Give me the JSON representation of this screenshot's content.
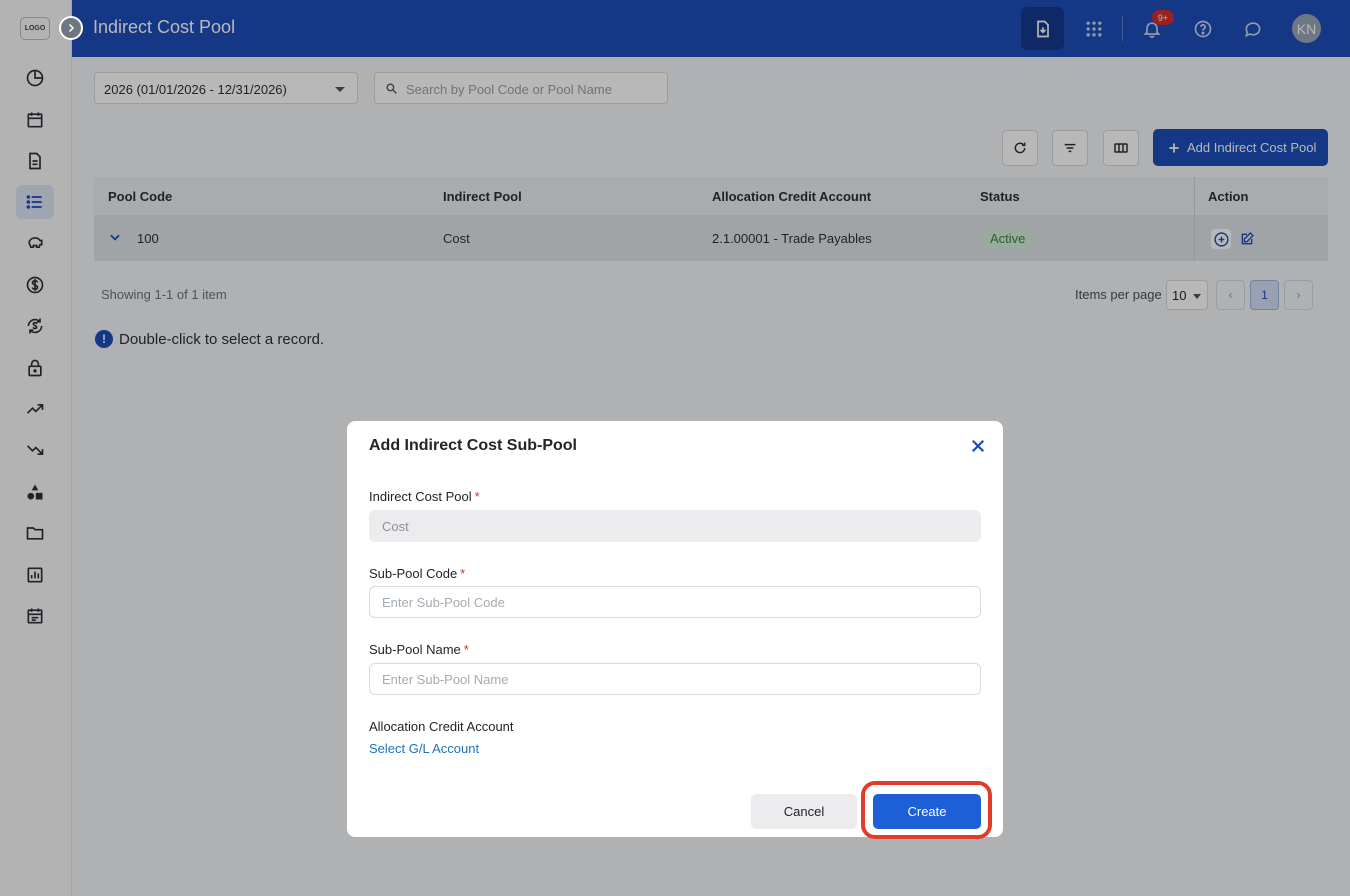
{
  "sidebar": {
    "logo_text": "LOGO",
    "items": [
      {
        "icon": "pie-chart-icon",
        "active": false
      },
      {
        "icon": "calendar-icon",
        "active": false
      },
      {
        "icon": "document-icon",
        "active": false
      },
      {
        "icon": "list-icon",
        "active": true
      },
      {
        "icon": "piggy-bank-icon",
        "active": false
      },
      {
        "icon": "dollar-icon",
        "active": false
      },
      {
        "icon": "currency-exchange-icon",
        "active": false
      },
      {
        "icon": "lock-icon",
        "active": false
      },
      {
        "icon": "trending-up-icon",
        "active": false
      },
      {
        "icon": "trending-down-icon",
        "active": false
      },
      {
        "icon": "shapes-icon",
        "active": false
      },
      {
        "icon": "folder-icon",
        "active": false
      },
      {
        "icon": "bar-chart-icon",
        "active": false
      },
      {
        "icon": "event-calendar-icon",
        "active": false
      }
    ]
  },
  "header": {
    "title": "Indirect Cost Pool",
    "notification_badge": "9+",
    "avatar_initials": "KN"
  },
  "filters": {
    "fiscal_year": "2026 (01/01/2026 - 12/31/2026)",
    "search_placeholder": "Search by Pool Code or Pool Name"
  },
  "toolbar": {
    "add_label": "Add Indirect Cost Pool"
  },
  "table": {
    "columns": [
      "Pool Code",
      "Indirect Pool",
      "Allocation Credit Account",
      "Status",
      "Action"
    ],
    "rows": [
      {
        "pool_code": "100",
        "indirect_pool": "Cost",
        "account": "2.1.00001 - Trade Payables",
        "status": "Active"
      }
    ]
  },
  "pagination": {
    "showing": "Showing 1-1 of 1 item",
    "items_per_page_label": "Items per page",
    "items_per_page": "10",
    "current_page": "1",
    "prev": "‹",
    "next": "›"
  },
  "hint": {
    "icon_text": "!",
    "text": "Double-click to select a record."
  },
  "modal": {
    "title": "Add Indirect Cost Sub-Pool",
    "pool_label": "Indirect Cost Pool",
    "pool_value": "Cost",
    "code_label": "Sub-Pool Code",
    "code_placeholder": "Enter Sub-Pool Code",
    "name_label": "Sub-Pool Name",
    "name_placeholder": "Enter Sub-Pool Name",
    "account_label": "Allocation Credit Account",
    "account_link": "Select G/L Account",
    "required_mark": "*",
    "cancel_label": "Cancel",
    "create_label": "Create"
  },
  "colors": {
    "brand": "#1d4dba",
    "highlight": "#e23b2a",
    "status_active": "#2f8a43"
  }
}
